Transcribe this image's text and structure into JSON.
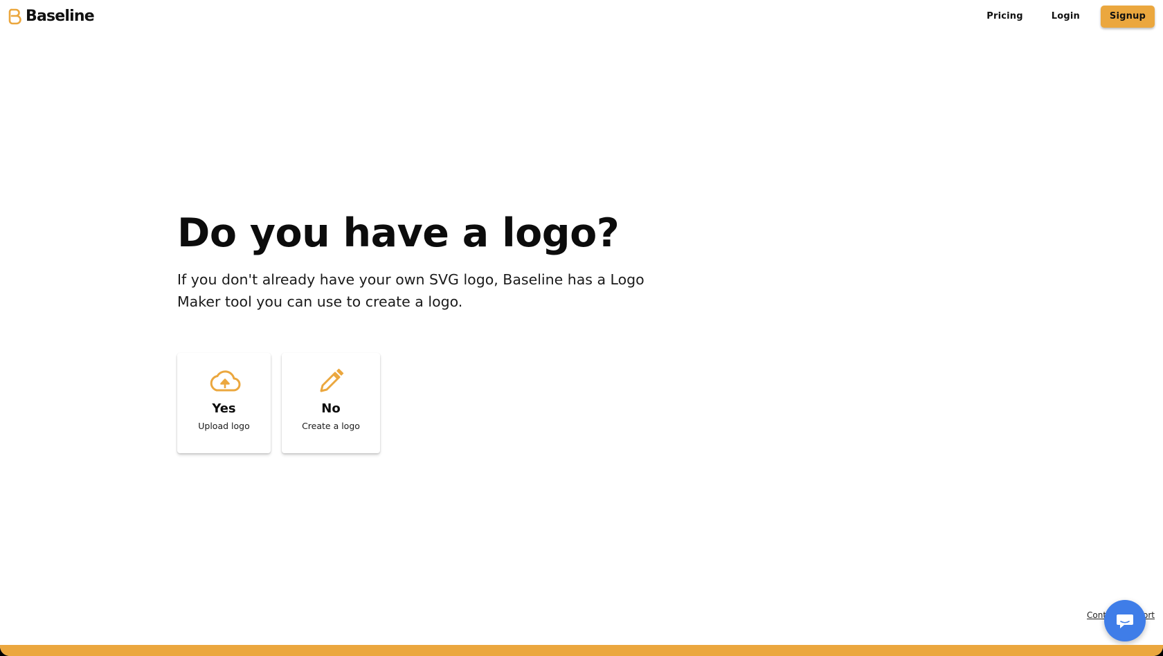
{
  "header": {
    "brand_name": "Baseline",
    "nav": {
      "pricing_label": "Pricing",
      "login_label": "Login",
      "signup_label": "Signup"
    }
  },
  "main": {
    "title": "Do you have a logo?",
    "subtitle": "If you don't already have your own SVG logo, Baseline has a Logo Maker tool you can use to create a logo.",
    "options": [
      {
        "title": "Yes",
        "subtitle": "Upload logo",
        "icon": "cloud-upload-icon"
      },
      {
        "title": "No",
        "subtitle": "Create a logo",
        "icon": "pencil-icon"
      }
    ]
  },
  "footer": {
    "support_label": "Contact Support",
    "chat_icon": "chat-bubble-icon"
  },
  "colors": {
    "accent": "#eba73e",
    "chat": "#3f7de8",
    "text": "#0c0c0c",
    "background": "#ffffff"
  }
}
